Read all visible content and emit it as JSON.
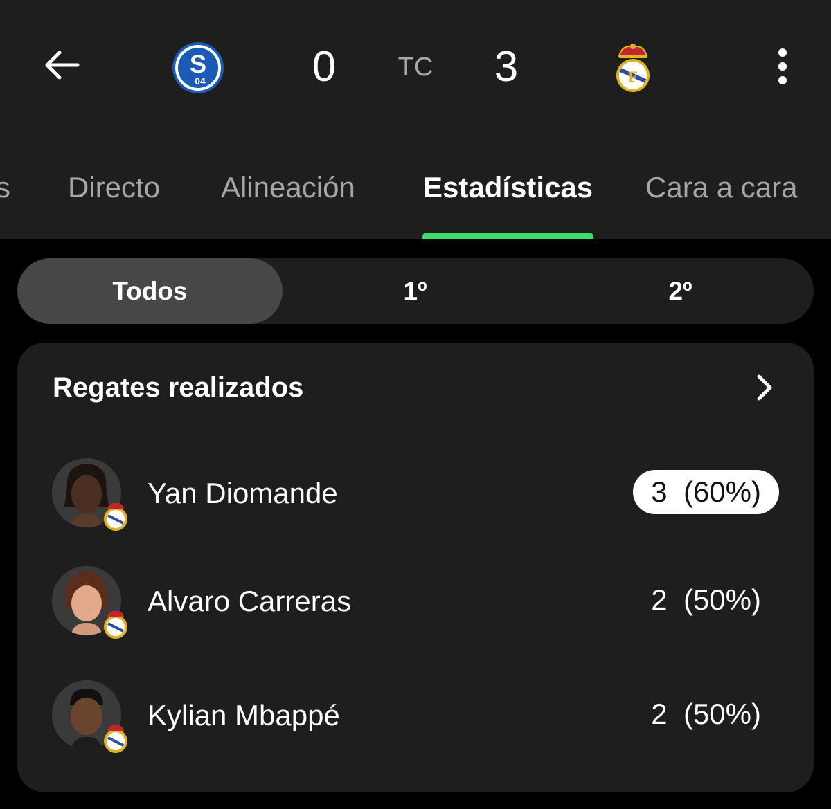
{
  "match": {
    "home_team": "Schalke 04",
    "away_team": "Real Madrid",
    "home_score": "0",
    "away_score": "3",
    "status": "TC",
    "home_logo_text": "S",
    "home_logo_sub": "04"
  },
  "icons": {
    "back": "arrow-left-icon",
    "more": "vertical-dots-icon",
    "chevron": "chevron-right-icon"
  },
  "tabs": [
    {
      "label": "s",
      "active": false
    },
    {
      "label": "Directo",
      "active": false
    },
    {
      "label": "Alineación",
      "active": false
    },
    {
      "label": "Estadísticas",
      "active": true
    },
    {
      "label": "Cara a cara",
      "active": false
    }
  ],
  "segments": [
    {
      "label": "Todos",
      "active": true
    },
    {
      "label": "1º",
      "active": false
    },
    {
      "label": "2º",
      "active": false
    }
  ],
  "stat_card": {
    "title": "Regates realizados",
    "players": [
      {
        "name": "Yan Diomande",
        "value": "3  (60%)",
        "highlight": true
      },
      {
        "name": "Alvaro Carreras",
        "value": "2  (50%)",
        "highlight": false
      },
      {
        "name": "Kylian Mbappé",
        "value": "2  (50%)",
        "highlight": false
      }
    ]
  },
  "colors": {
    "accent": "#3ddc6b",
    "surface": "#1e1e1e",
    "background": "#000000",
    "schalke_blue": "#1a5bb8",
    "madrid_gold": "#e0b326"
  }
}
